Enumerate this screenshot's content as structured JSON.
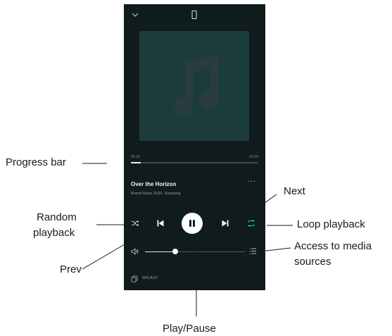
{
  "player": {
    "elapsed": "00:16",
    "remaining": "-03:29",
    "progress": 0.08,
    "track_title": "Over the Horizon",
    "track_subtitle": "Brand Music 2020, Samsung",
    "more_glyph": "···",
    "volume": 0.3,
    "cast_label": "WICAST"
  },
  "annotations": {
    "progress_bar": "Progress bar",
    "next": "Next",
    "random_playback_line1": "Random",
    "random_playback_line2": "playback",
    "loop_playback": "Loop playback",
    "access_media_line1": "Access to media",
    "access_media_line2": "sources",
    "prev": "Prev",
    "play_pause": "Play/Pause"
  },
  "colors": {
    "background": "#0f1b1c",
    "album_art": "#1c3c3c",
    "music_note": "#2b3c3e",
    "accent_loop": "#1ed5a0"
  },
  "icons": [
    "chevron-down-icon",
    "device-icon",
    "music-note-icon",
    "shuffle-icon",
    "previous-icon",
    "pause-icon",
    "next-icon",
    "loop-icon",
    "volume-icon",
    "queue-icon",
    "cast-icon"
  ]
}
